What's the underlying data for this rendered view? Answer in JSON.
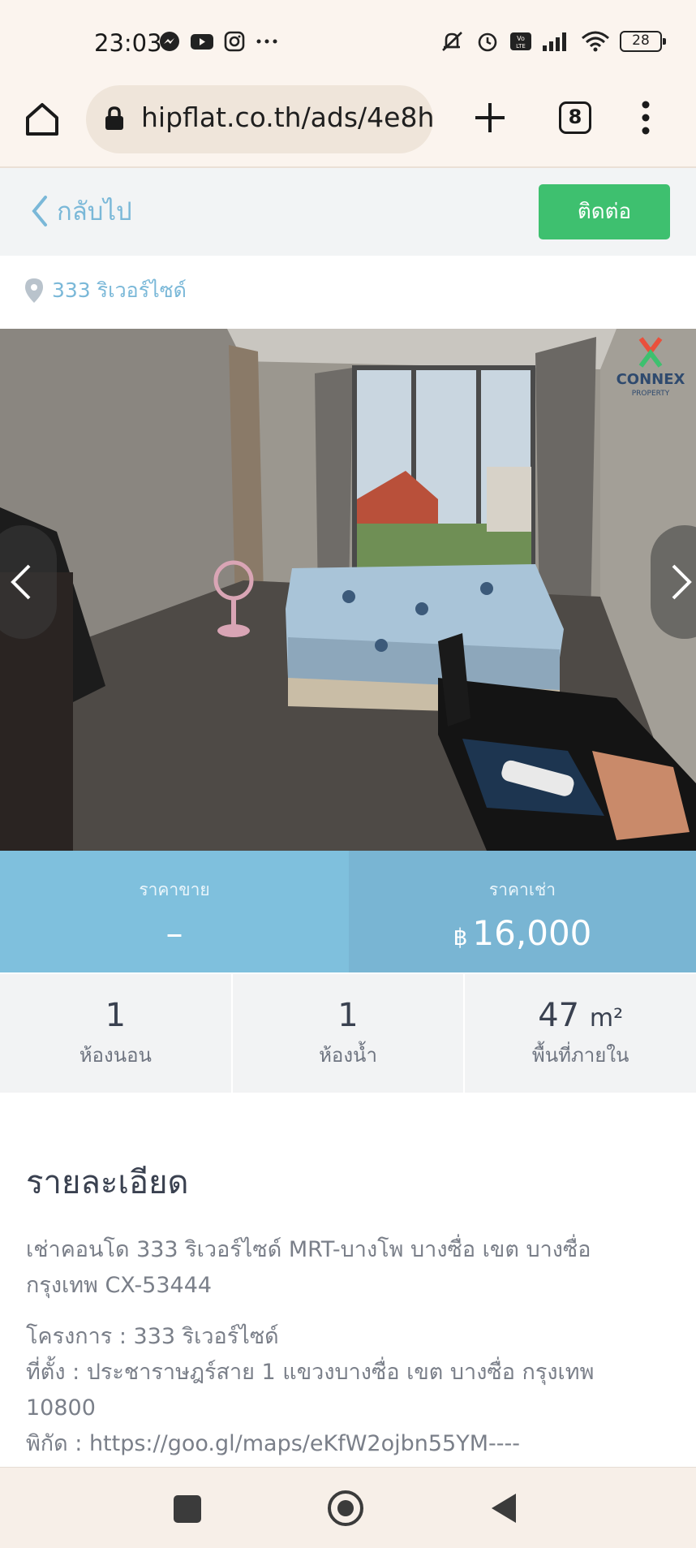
{
  "status_bar": {
    "time": "23:03",
    "left_icons": [
      "messenger-icon",
      "youtube-icon",
      "instagram-icon",
      "more-dots-icon"
    ],
    "right_icons": [
      "mute-icon",
      "alarm-icon",
      "volte-icon",
      "signal-icon",
      "wifi-icon"
    ],
    "battery": "28"
  },
  "browser": {
    "url": "hipflat.co.th/ads/4e8h",
    "tab_count": "8"
  },
  "header": {
    "back_label": "กลับไป",
    "contact_label": "ติดต่อ"
  },
  "location": "333 ริเวอร์ไซด์",
  "photo": {
    "description_icon": "bedroom-photo",
    "watermark_text": "CONNEX",
    "watermark_sub": "PROPERTY"
  },
  "price": {
    "sale_label": "ราคาขาย",
    "sale_value": "–",
    "rent_label": "ราคาเช่า",
    "currency": "฿",
    "rent_value": "16,000"
  },
  "stats": {
    "bedrooms_value": "1",
    "bedrooms_label": "ห้องนอน",
    "bathrooms_value": "1",
    "bathrooms_label": "ห้องน้ำ",
    "area_value": "47",
    "area_unit": "m²",
    "area_label": "พื้นที่ภายใน"
  },
  "details": {
    "title": "รายละเอียด",
    "summary": "เช่าคอนโด 333 ริเวอร์ไซด์ MRT-บางโพ บางซื่อ เขต บางซื่อ กรุงเทพ CX-53444",
    "line1": "โครงการ : 333 ริเวอร์ไซด์",
    "line2": "ที่ตั้ง : ประชาราษฎร์สาย 1 แขวงบางซื่อ เขต บางซื่อ กรุงเทพ 10800",
    "line3": "พิกัด : https://goo.gl/maps/eKfW2ojbn55YM----"
  },
  "colors": {
    "accent_green": "#3ec06f",
    "link_blue": "#7ab8d8",
    "price_blue": "#7fc0dd"
  }
}
